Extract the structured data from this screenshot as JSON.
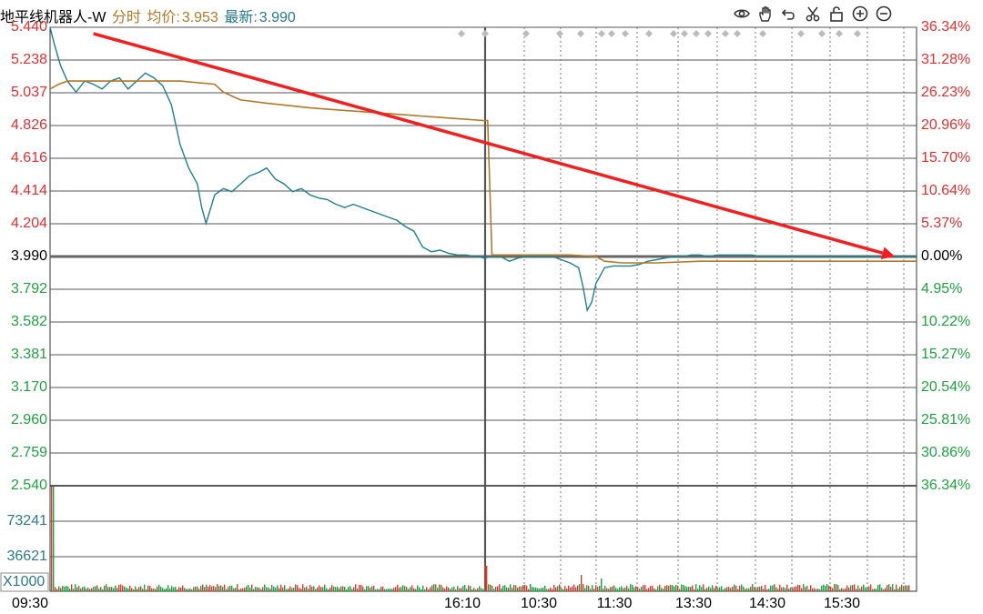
{
  "header": {
    "stock_name": "地平线机器人-W",
    "tab_label": "分时",
    "avg_label": "均价:",
    "avg_value": "3.953",
    "last_label": "最新:",
    "last_value": "3.990"
  },
  "toolbar": [
    "eye-icon",
    "hand-icon",
    "undo-icon",
    "scissors-icon",
    "lock-icon",
    "zoom-in-icon",
    "zoom-out-icon"
  ],
  "colors": {
    "price_line": "#1f7f8f",
    "avg_line": "#b07a2a",
    "up": "#e03030",
    "down": "#20a040",
    "arrow": "#f02020",
    "grid": "#555555",
    "volume_up": "#d04030",
    "volume_down": "#20a040"
  },
  "chart_data": {
    "type": "line",
    "price_axis": {
      "ticks": [
        "5.440",
        "5.238",
        "5.037",
        "4.826",
        "4.616",
        "4.414",
        "4.204",
        "3.990",
        "3.792",
        "3.582",
        "3.381",
        "3.170",
        "2.960",
        "2.759",
        "2.540"
      ],
      "range": [
        2.54,
        5.44
      ],
      "reference": 3.99
    },
    "pct_axis": {
      "ticks": [
        "36.34%",
        "31.28%",
        "26.23%",
        "20.96%",
        "15.70%",
        "10.64%",
        "5.37%",
        "0.00%",
        "4.95%",
        "10.22%",
        "15.27%",
        "20.54%",
        "25.81%",
        "30.86%",
        "36.34%"
      ]
    },
    "time_axis": {
      "labels": [
        "09:30",
        "16:10",
        "10:30",
        "11:30",
        "13:30",
        "14:30",
        "15:30"
      ]
    },
    "volume_axis": {
      "ticks": [
        "73241",
        "36621"
      ],
      "unit_label": "X1000"
    },
    "series": [
      {
        "x": [
          0,
          0.005,
          0.012,
          0.02,
          0.03,
          0.04,
          0.05,
          0.06,
          0.07,
          0.08,
          0.09,
          0.1,
          0.11,
          0.12,
          0.13,
          0.14,
          0.15,
          0.16,
          0.17,
          0.175,
          0.18,
          0.19,
          0.2,
          0.21,
          0.22,
          0.23,
          0.24,
          0.25,
          0.26,
          0.27,
          0.28,
          0.29,
          0.3,
          0.31,
          0.32,
          0.33,
          0.34,
          0.35,
          0.36,
          0.37,
          0.38,
          0.39,
          0.4,
          0.41,
          0.42,
          0.43,
          0.44,
          0.45,
          0.46,
          0.47,
          0.48,
          0.49,
          0.495,
          0.5,
          0.51,
          0.52,
          0.53,
          0.54,
          0.55,
          0.56,
          0.57,
          0.58,
          0.59,
          0.6,
          0.61,
          0.615,
          0.62,
          0.625,
          0.63,
          0.64,
          0.65,
          0.66,
          0.67,
          0.68,
          0.69,
          0.7,
          0.71,
          0.72,
          0.73,
          0.74,
          0.75,
          0.76,
          0.77,
          0.78,
          0.79,
          0.8,
          0.81,
          0.82,
          0.83,
          0.84,
          0.85,
          0.86,
          0.87,
          0.88,
          0.89,
          0.9,
          0.91,
          0.92,
          0.93,
          0.94,
          0.95,
          0.96,
          0.97,
          0.98,
          0.99,
          1.0
        ],
        "values": [
          5.44,
          5.33,
          5.2,
          5.1,
          5.03,
          5.1,
          5.08,
          5.05,
          5.1,
          5.12,
          5.05,
          5.1,
          5.15,
          5.12,
          5.07,
          4.95,
          4.7,
          4.55,
          4.45,
          4.3,
          4.2,
          4.38,
          4.42,
          4.4,
          4.45,
          4.5,
          4.52,
          4.55,
          4.48,
          4.45,
          4.4,
          4.42,
          4.38,
          4.36,
          4.35,
          4.32,
          4.3,
          4.32,
          4.3,
          4.28,
          4.26,
          4.24,
          4.22,
          4.18,
          4.15,
          4.05,
          4.02,
          4.03,
          4.01,
          4.0,
          4.0,
          3.99,
          3.99,
          3.98,
          3.99,
          3.99,
          3.96,
          3.98,
          3.99,
          3.99,
          3.99,
          3.99,
          3.97,
          3.95,
          3.92,
          3.8,
          3.65,
          3.7,
          3.82,
          3.92,
          3.93,
          3.93,
          3.93,
          3.94,
          3.96,
          3.97,
          3.98,
          3.99,
          3.99,
          4.0,
          4.0,
          3.99,
          4.0,
          4.0,
          4.0,
          4.0,
          4.0,
          3.99,
          3.99,
          3.99,
          3.99,
          3.99,
          3.99,
          3.99,
          3.99,
          3.99,
          3.99,
          3.99,
          3.99,
          3.99,
          3.99,
          3.99,
          3.99,
          3.99,
          3.99,
          3.99
        ]
      },
      {
        "x": [
          0,
          0.01,
          0.02,
          0.05,
          0.1,
          0.15,
          0.19,
          0.2,
          0.22,
          0.25,
          0.3,
          0.35,
          0.4,
          0.45,
          0.5,
          0.505,
          0.51,
          0.52,
          0.55,
          0.6,
          0.63,
          0.64,
          0.66,
          0.7,
          0.75,
          0.8,
          0.85,
          0.9,
          0.95,
          1.0
        ],
        "values": [
          5.05,
          5.08,
          5.1,
          5.1,
          5.1,
          5.1,
          5.08,
          5.03,
          4.98,
          4.96,
          4.93,
          4.91,
          4.89,
          4.87,
          4.85,
          4.85,
          4.0,
          4.0,
          4.0,
          4.0,
          3.99,
          3.96,
          3.95,
          3.95,
          3.96,
          3.96,
          3.96,
          3.96,
          3.96,
          3.96
        ]
      }
    ],
    "annotations": [
      {
        "type": "arrow",
        "from": {
          "x": 0.05,
          "y": 5.4
        },
        "to": {
          "x": 0.975,
          "y": 3.99
        }
      }
    ],
    "grid": true
  }
}
